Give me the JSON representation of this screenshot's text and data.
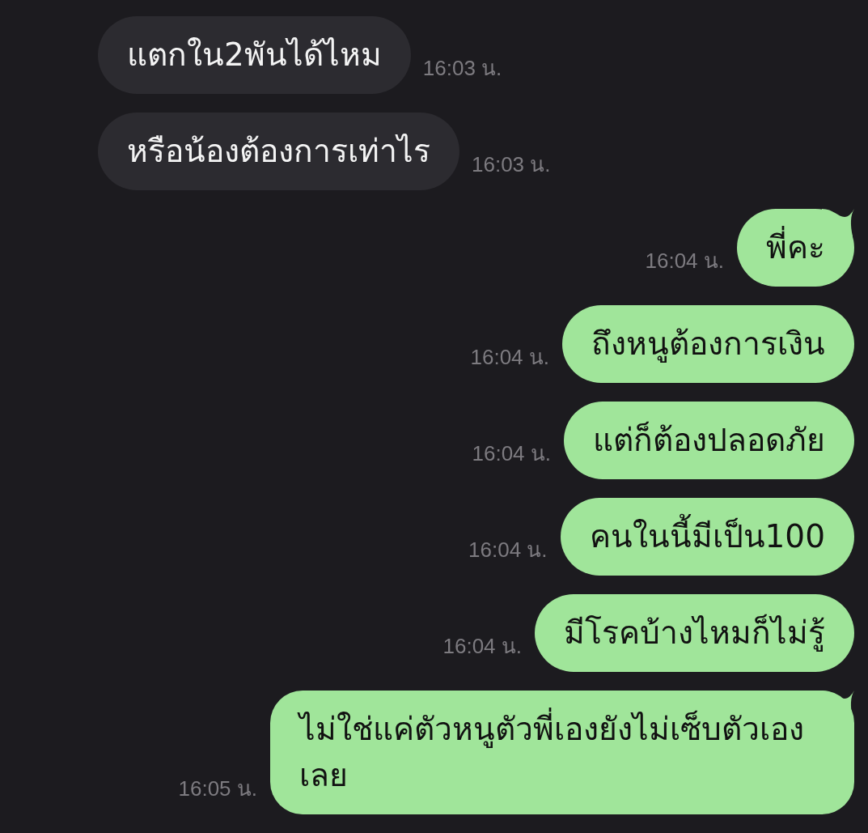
{
  "messages": [
    {
      "kind": "incoming",
      "text": "แตกใน2พันได้ไหม",
      "time": "16:03 น.",
      "tail": false
    },
    {
      "kind": "incoming",
      "text": "หรือน้องต้องการเท่าไร",
      "time": "16:03 น.",
      "tail": false
    },
    {
      "kind": "outgoing",
      "text": "พี่คะ",
      "time": "16:04 น.",
      "tail": true
    },
    {
      "kind": "outgoing",
      "text": "ถึงหนูต้องการเงิน",
      "time": "16:04 น.",
      "tail": false
    },
    {
      "kind": "outgoing",
      "text": "แต่ก็ต้องปลอดภัย",
      "time": "16:04 น.",
      "tail": false
    },
    {
      "kind": "outgoing",
      "text": "คนในนี้มีเป็น100",
      "time": "16:04 น.",
      "tail": false
    },
    {
      "kind": "outgoing",
      "text": "มีโรคบ้างไหมก็ไม่รู้",
      "time": "16:04 น.",
      "tail": false
    },
    {
      "kind": "outgoing",
      "text": "ไม่ใช่แค่ตัวหนูตัวพี่เองยังไม่เซ็บตัวเองเลย",
      "time": "16:05 น.",
      "tail": true
    }
  ]
}
